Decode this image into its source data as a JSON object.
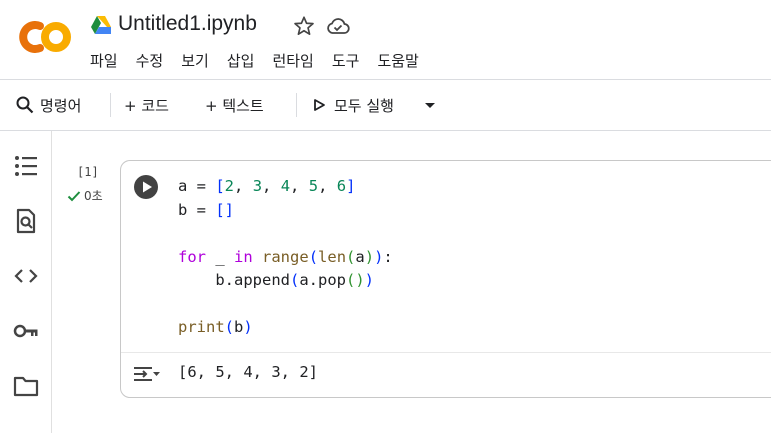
{
  "header": {
    "title": "Untitled1.ipynb",
    "menu": [
      "파일",
      "수정",
      "보기",
      "삽입",
      "런타임",
      "도구",
      "도움말"
    ]
  },
  "toolbar": {
    "command_label": "명령어",
    "code_label": "+ 코드",
    "text_label": "+ 텍스트",
    "run_all_label": "모두 실행"
  },
  "sidebar": {
    "icons": [
      "table-of-contents-icon",
      "find-icon",
      "code-snippets-icon",
      "secrets-key-icon",
      "folder-icon"
    ]
  },
  "cell": {
    "execution_count": "[1]",
    "exec_time": "0초",
    "code_lines": [
      "a = [2, 3, 4, 5, 6]",
      "b = []",
      "",
      "for _ in range(len(a)):",
      "    b.append(a.pop())",
      "",
      "print(b)"
    ],
    "output": "[6, 5, 4, 3, 2]"
  },
  "colors": {
    "logo_orange": "#f9ab00",
    "logo_dark_orange": "#e8710a",
    "check_green": "#1e8e3e",
    "keyword": "#af00db",
    "function": "#795e26",
    "number": "#098658"
  }
}
